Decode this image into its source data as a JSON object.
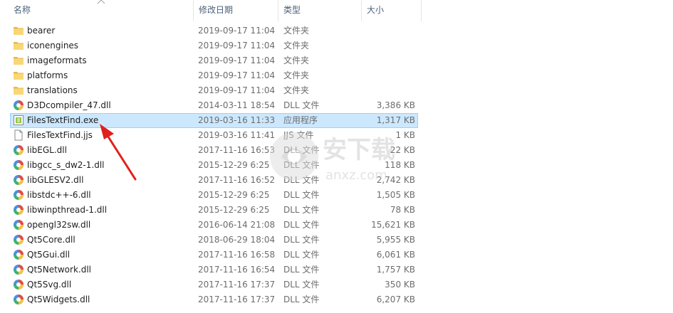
{
  "header": {
    "name": "名称",
    "date": "修改日期",
    "type": "类型",
    "size": "大小"
  },
  "rows": [
    {
      "name": "bearer",
      "date": "2019-09-17 11:04",
      "type": "文件夹",
      "size": "",
      "icon": "folder-icon"
    },
    {
      "name": "iconengines",
      "date": "2019-09-17 11:04",
      "type": "文件夹",
      "size": "",
      "icon": "folder-icon"
    },
    {
      "name": "imageformats",
      "date": "2019-09-17 11:04",
      "type": "文件夹",
      "size": "",
      "icon": "folder-icon"
    },
    {
      "name": "platforms",
      "date": "2019-09-17 11:04",
      "type": "文件夹",
      "size": "",
      "icon": "folder-icon"
    },
    {
      "name": "translations",
      "date": "2019-09-17 11:04",
      "type": "文件夹",
      "size": "",
      "icon": "folder-icon"
    },
    {
      "name": "D3Dcompiler_47.dll",
      "date": "2014-03-11 18:54",
      "type": "DLL 文件",
      "size": "3,386 KB",
      "icon": "dll-icon"
    },
    {
      "name": "FilesTextFind.exe",
      "date": "2019-03-16 11:33",
      "type": "应用程序",
      "size": "1,317 KB",
      "icon": "exe-icon",
      "selected": true
    },
    {
      "name": "FilesTextFind.jjs",
      "date": "2019-03-16 11:41",
      "type": "JJS 文件",
      "size": "1 KB",
      "icon": "file-icon"
    },
    {
      "name": "libEGL.dll",
      "date": "2017-11-16 16:53",
      "type": "DLL 文件",
      "size": "22 KB",
      "icon": "dll-icon"
    },
    {
      "name": "libgcc_s_dw2-1.dll",
      "date": "2015-12-29 6:25",
      "type": "DLL 文件",
      "size": "118 KB",
      "icon": "dll-icon"
    },
    {
      "name": "libGLESV2.dll",
      "date": "2017-11-16 16:52",
      "type": "DLL 文件",
      "size": "2,742 KB",
      "icon": "dll-icon"
    },
    {
      "name": "libstdc++-6.dll",
      "date": "2015-12-29 6:25",
      "type": "DLL 文件",
      "size": "1,505 KB",
      "icon": "dll-icon"
    },
    {
      "name": "libwinpthread-1.dll",
      "date": "2015-12-29 6:25",
      "type": "DLL 文件",
      "size": "78 KB",
      "icon": "dll-icon"
    },
    {
      "name": "opengl32sw.dll",
      "date": "2016-06-14 21:08",
      "type": "DLL 文件",
      "size": "15,621 KB",
      "icon": "dll-icon"
    },
    {
      "name": "Qt5Core.dll",
      "date": "2018-06-29 18:04",
      "type": "DLL 文件",
      "size": "5,955 KB",
      "icon": "dll-icon"
    },
    {
      "name": "Qt5Gui.dll",
      "date": "2017-11-16 16:58",
      "type": "DLL 文件",
      "size": "6,061 KB",
      "icon": "dll-icon"
    },
    {
      "name": "Qt5Network.dll",
      "date": "2017-11-16 16:54",
      "type": "DLL 文件",
      "size": "1,757 KB",
      "icon": "dll-icon"
    },
    {
      "name": "Qt5Svg.dll",
      "date": "2017-11-16 17:37",
      "type": "DLL 文件",
      "size": "350 KB",
      "icon": "dll-icon"
    },
    {
      "name": "Qt5Widgets.dll",
      "date": "2017-11-16 17:37",
      "type": "DLL 文件",
      "size": "6,207 KB",
      "icon": "dll-icon"
    }
  ],
  "watermark": {
    "brand": "安下载",
    "domain": "anxz.com"
  },
  "colors": {
    "selection": "#cce8ff",
    "selection_border": "#99d1ff",
    "folder": "#f8d775",
    "arrow": "#e0201c"
  }
}
